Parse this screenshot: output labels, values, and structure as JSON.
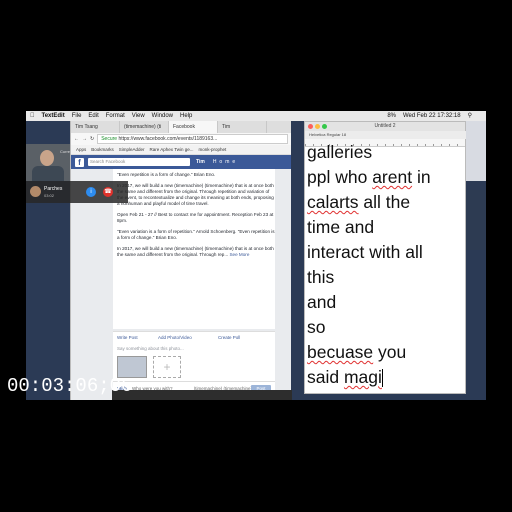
{
  "menubar": {
    "app": "TextEdit",
    "items": [
      "File",
      "Edit",
      "Format",
      "View",
      "Window",
      "Help"
    ],
    "clock": "Wed Feb 22  17:32:18",
    "battery": "8%"
  },
  "browser": {
    "tabs": [
      "Tim Tsang",
      "(timemachine) (ti",
      "Facebook",
      "Tim"
    ],
    "url_secure": "Secure",
    "url": "https://www.facebook.com/events/1189163...",
    "bookmarks": [
      "Apps",
      "Bookmarks",
      "SimpleAdder",
      "Rare Aphex Twin ge...",
      "monk-prophet"
    ],
    "fb_search_placeholder": "Search Facebook",
    "fb_user": "Tim",
    "fb_icons": "Home",
    "post_paragraphs": [
      "\"Even repetition is a form of change.\" Brian Eno.",
      "In 2017, we will build a new (timemachine) (timemachine) that is at once both the same and different from the original. Through repetition and variation of the event, to recontextualize and change its meaning at both ends, proposing a nonhuman and playful model of time travel.",
      "Open Feb 21 - 27 // Best to contact me for appointment. Reception Feb 23 at 8pm.",
      "\"Even variation is a form of repetition.\" Arnold Schoenberg. \"Even repetition is a form of change.\" Brian Eno.",
      "In 2017, we will build a new (timemachine) (timemachine) that is at once both the same and different from the original. Through rep..."
    ],
    "see_more": "See More",
    "compose_tabs": [
      "Write Post",
      "Add Photo/Video",
      "Create Poll"
    ],
    "compose_placeholder": "Say something about this photo...",
    "with_label": "With",
    "with_placeholder": "Who were you with?",
    "target": "(timemachine) (timemachine)",
    "post_button": "Post",
    "chat_user": "Andrée Azzolina",
    "chat": "Chat (65)"
  },
  "call": {
    "label": "Current Call",
    "name": "Parches",
    "duration": "03:02"
  },
  "textedit": {
    "title": "Untitled 2",
    "toolbar": "Helvetica   Regular   18",
    "lines": [
      {
        "text": "galleries"
      },
      {
        "pre": "ppl who ",
        "err": "arent",
        "post": " in"
      },
      {
        "err": "calarts",
        "post": " all the"
      },
      {
        "text": "time and"
      },
      {
        "text": "interact with all"
      },
      {
        "text": "this"
      },
      {
        "text": "and"
      },
      {
        "text": "so"
      },
      {
        "err": "becuase",
        "post": " you"
      },
      {
        "pre": "said ",
        "err": "magi"
      }
    ]
  },
  "timecode": "00:03:06;06",
  "colors": {
    "fb_blue": "#3b5998",
    "hangup": "#e0312b",
    "spell_error": "#e03030"
  }
}
